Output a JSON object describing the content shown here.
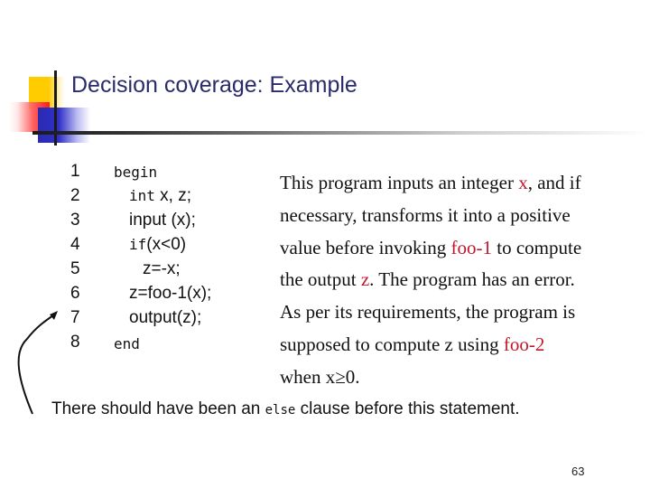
{
  "slide": {
    "title": "Decision coverage: Example",
    "page_number": "63",
    "accent_color": "#2b2b6b",
    "highlight_color": "#c0182a"
  },
  "code": {
    "lines": [
      {
        "num": "1",
        "text": "begin"
      },
      {
        "num": "2",
        "text": "int x, z;"
      },
      {
        "num": "3",
        "text": "input (x);"
      },
      {
        "num": "4",
        "text": "if(x<0)"
      },
      {
        "num": "5",
        "text": "z=-x;"
      },
      {
        "num": "6",
        "text": "z=foo-1(x);"
      },
      {
        "num": "7",
        "text": "output(z);"
      },
      {
        "num": "8",
        "text": "end"
      }
    ]
  },
  "description": {
    "l1a": "This program inputs an integer ",
    "l1x": "x",
    "l1b": ", and if",
    "l2": "necessary, transforms it into a positive",
    "l3a": "value before invoking ",
    "l3f": "foo-1",
    "l3b": " to compute",
    "l4a": "the output ",
    "l4z": "z",
    "l4b": ".  The program has an error.",
    "l5": "As per its requirements, the program is",
    "l6a": "supposed to compute z using ",
    "l6f": "foo-2",
    "l7": "when x≥0."
  },
  "annotation": {
    "before": "There should have been an ",
    "keyword": "else",
    "after": " clause before this statement.",
    "arrow_icon": "curved-arrow-icon"
  }
}
